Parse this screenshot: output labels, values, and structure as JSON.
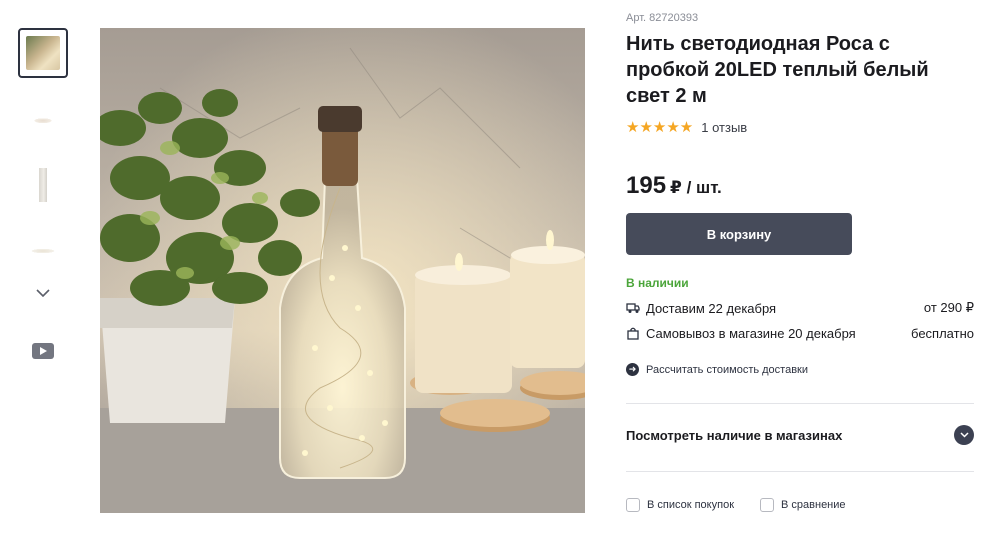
{
  "product": {
    "article": "Арт. 82720393",
    "title": "Нить светодиодная Роса с пробкой 20LED теплый белый свет 2 м",
    "rating_stars": "★★★★★",
    "rating_value": 5,
    "reviews": "1 отзыв",
    "price": "195",
    "price_unit": "₽ / шт.",
    "cart_button": "В корзину",
    "stock": "В наличии"
  },
  "delivery": [
    {
      "icon": "truck-icon",
      "label": "Доставим 22 декабря",
      "value": "от 290 ₽"
    },
    {
      "icon": "bag-icon",
      "label": "Самовывоз в магазине 20 декабря",
      "value": "бесплатно"
    }
  ],
  "calc_link": "Рассчитать стоимость доставки",
  "stores_label": "Посмотреть наличие в магазинах",
  "checkboxes": [
    "В список покупок",
    "В сравнение"
  ],
  "colors": {
    "button": "#464b5a",
    "stock_green": "#4ba53a",
    "star": "#f5a623"
  },
  "gallery": {
    "thumbnails": [
      "photo-thumb-1",
      "photo-thumb-2",
      "photo-thumb-3",
      "photo-thumb-4"
    ],
    "more_icon": "chevron-down-icon",
    "video_icon": "video-play-icon"
  }
}
